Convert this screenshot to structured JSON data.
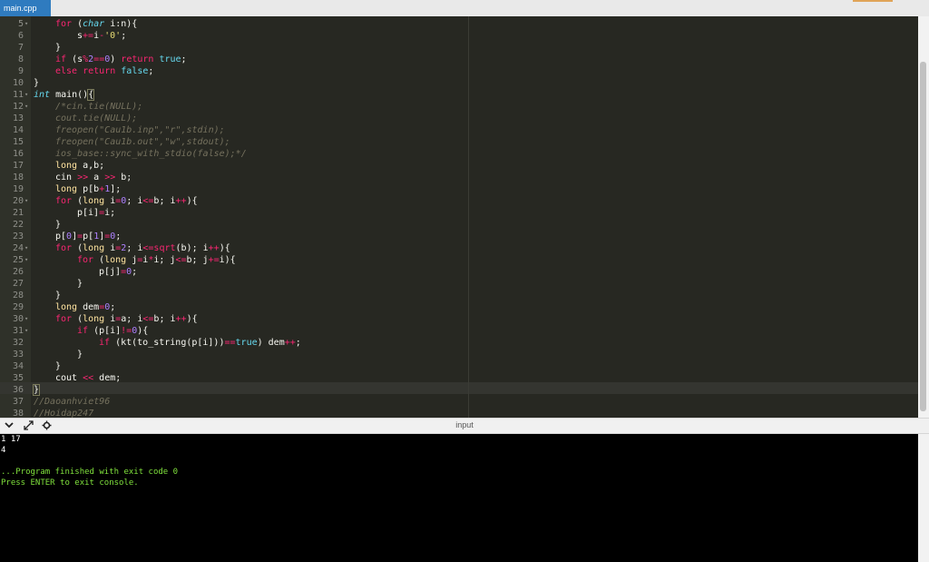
{
  "editor": {
    "tab_label": "main.cpp",
    "lines": [
      {
        "n": "5",
        "fold": "▾"
      },
      {
        "n": "6",
        "fold": ""
      },
      {
        "n": "7",
        "fold": ""
      },
      {
        "n": "8",
        "fold": ""
      },
      {
        "n": "9",
        "fold": ""
      },
      {
        "n": "10",
        "fold": ""
      },
      {
        "n": "11",
        "fold": "▾"
      },
      {
        "n": "12",
        "fold": "▾"
      },
      {
        "n": "13",
        "fold": ""
      },
      {
        "n": "14",
        "fold": ""
      },
      {
        "n": "15",
        "fold": ""
      },
      {
        "n": "16",
        "fold": ""
      },
      {
        "n": "17",
        "fold": ""
      },
      {
        "n": "18",
        "fold": ""
      },
      {
        "n": "19",
        "fold": ""
      },
      {
        "n": "20",
        "fold": "▾"
      },
      {
        "n": "21",
        "fold": ""
      },
      {
        "n": "22",
        "fold": ""
      },
      {
        "n": "23",
        "fold": ""
      },
      {
        "n": "24",
        "fold": "▾"
      },
      {
        "n": "25",
        "fold": "▾"
      },
      {
        "n": "26",
        "fold": ""
      },
      {
        "n": "27",
        "fold": ""
      },
      {
        "n": "28",
        "fold": ""
      },
      {
        "n": "29",
        "fold": ""
      },
      {
        "n": "30",
        "fold": "▾"
      },
      {
        "n": "31",
        "fold": "▾"
      },
      {
        "n": "32",
        "fold": ""
      },
      {
        "n": "33",
        "fold": ""
      },
      {
        "n": "34",
        "fold": ""
      },
      {
        "n": "35",
        "fold": ""
      },
      {
        "n": "36",
        "fold": ""
      },
      {
        "n": "37",
        "fold": ""
      },
      {
        "n": "38",
        "fold": ""
      }
    ],
    "code": {
      "l5": [
        "for",
        " (",
        "char",
        " i:n){"
      ],
      "l6": [
        "s",
        "+=",
        "i",
        "-",
        "'0'",
        ";"
      ],
      "l7": [
        "}"
      ],
      "l8": [
        "if",
        " (s",
        "%",
        "2",
        "==",
        "0",
        ") ",
        "return",
        " ",
        "true",
        ";"
      ],
      "l9": [
        "else",
        " ",
        "return",
        " ",
        "false",
        ";"
      ],
      "l10": [
        "}"
      ],
      "l11": [
        "int",
        " main()",
        "{"
      ],
      "l12": [
        "/*cin.tie(NULL);"
      ],
      "l13": [
        "cout.tie(NULL);"
      ],
      "l14": [
        "freopen(\"Cau1b.inp\",\"r\",stdin);"
      ],
      "l15": [
        "freopen(\"Cau1b.out\",\"w\",stdout);"
      ],
      "l16": [
        "ios_base::sync_with_stdio(false);*/"
      ],
      "l17": [
        "long",
        " a,b;"
      ],
      "l18": [
        "cin ",
        ">>",
        " a ",
        ">>",
        " b;"
      ],
      "l19": [
        "long",
        " p[b",
        "+",
        "1",
        "];"
      ],
      "l20": [
        "for",
        " (",
        "long",
        " i",
        "=",
        "0",
        "; i",
        "<=",
        "b; i",
        "++",
        "){"
      ],
      "l21": [
        "p[i]",
        "=",
        "i;"
      ],
      "l22": [
        "}"
      ],
      "l23": [
        "p[",
        "0",
        "]",
        "=",
        "p[",
        "1",
        "]",
        "=",
        "0",
        ";"
      ],
      "l24": [
        "for",
        " (",
        "long",
        " i",
        "=",
        "2",
        "; i",
        "<=",
        "sqrt",
        "(b); i",
        "++",
        "){"
      ],
      "l25": [
        "for",
        " (",
        "long",
        " j",
        "=",
        "i",
        "*",
        "i; j",
        "<=",
        "b; j",
        "+=",
        "i){"
      ],
      "l26": [
        "p[j]",
        "=",
        "0",
        ";"
      ],
      "l27": [
        "}"
      ],
      "l28": [
        "}"
      ],
      "l29": [
        "long",
        " dem",
        "=",
        "0",
        ";"
      ],
      "l30": [
        "for",
        " (",
        "long",
        " i",
        "=",
        "a; i",
        "<=",
        "b; i",
        "++",
        "){"
      ],
      "l31": [
        "if",
        " (p[i]",
        "!=",
        "0",
        "){"
      ],
      "l32": [
        "if",
        " (kt(to_string(p[i]))",
        "==",
        "true",
        ") dem",
        "++",
        ";"
      ],
      "l33": [
        "}"
      ],
      "l34": [
        "}"
      ],
      "l35": [
        "cout ",
        "<<",
        " dem;"
      ],
      "l36": [
        "}"
      ],
      "l37": [
        "//Daoanhviet96"
      ],
      "l38": [
        "//Hoidap247"
      ]
    }
  },
  "toolbar": {
    "input_label": "input",
    "icons": [
      "chevron-down-icon",
      "expand-icon",
      "settings-icon"
    ]
  },
  "console": {
    "lines": [
      "1 17",
      "4",
      "",
      "...Program finished with exit code 0",
      "Press ENTER to exit console."
    ]
  },
  "colors": {
    "editor_bg": "#272822",
    "keyword": "#f92672",
    "type": "#66d9ef",
    "number": "#ae81ff",
    "string": "#e6db74",
    "comment": "#75715e",
    "console_green": "#7fe03c",
    "tab_active": "#2f7bbf"
  }
}
